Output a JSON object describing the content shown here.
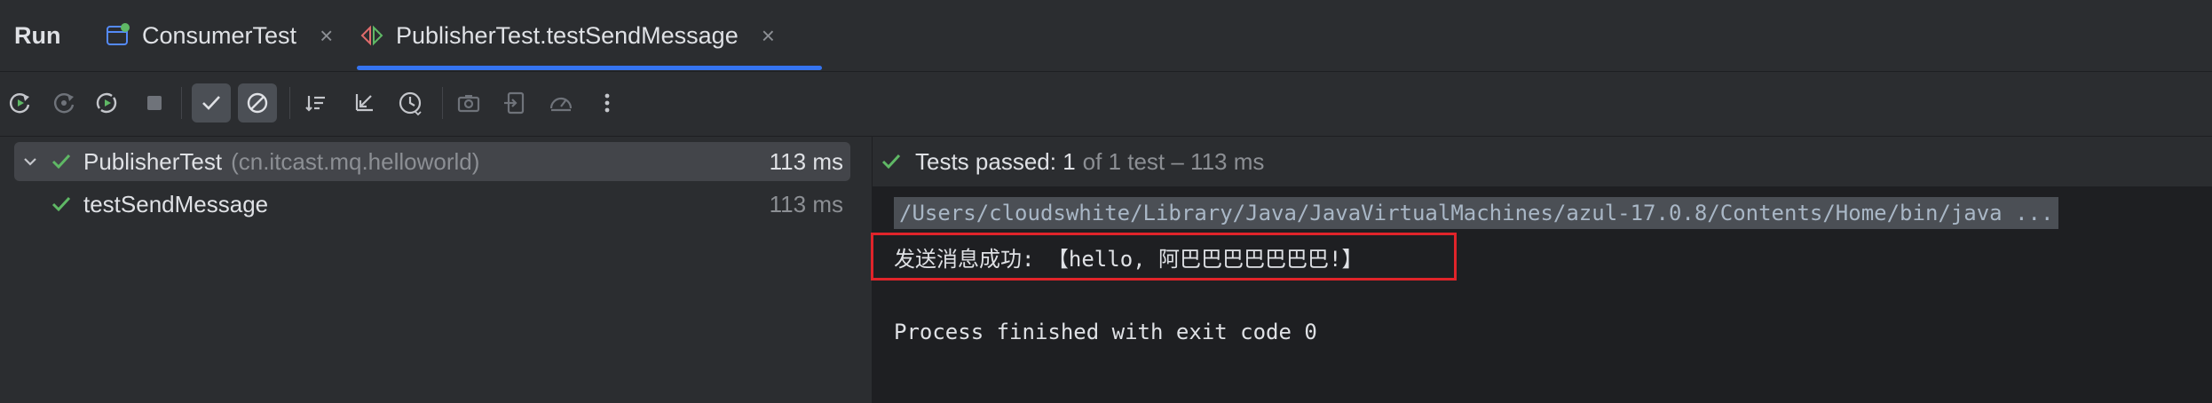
{
  "header": {
    "run_label": "Run",
    "tabs": [
      {
        "label": "ConsumerTest",
        "icon": "test-class-icon",
        "close": "×"
      },
      {
        "label": "PublisherTest.testSendMessage",
        "icon": "junit-icon",
        "close": "×",
        "active": true
      }
    ]
  },
  "toolbar": {
    "buttons": [
      "rerun-icon",
      "rerun-failed-icon",
      "toggle-auto-test-icon",
      "stop-icon",
      "show-passed-icon",
      "show-ignored-icon",
      "sort-alphabetically-icon",
      "collapse-all-icon",
      "sort-by-duration-icon",
      "screenshot-icon",
      "import-tests-icon",
      "coverage-icon",
      "more-icon"
    ]
  },
  "tree": {
    "root": {
      "name": "PublisherTest",
      "package": "(cn.itcast.mq.helloworld)",
      "duration": "113 ms"
    },
    "child": {
      "name": "testSendMessage",
      "duration": "113 ms"
    }
  },
  "console": {
    "status_passed": "Tests passed: 1",
    "status_detail": "of 1 test – 113 ms",
    "cmd": "/Users/cloudswhite/Library/Java/JavaVirtualMachines/azul-17.0.8/Contents/Home/bin/java ...",
    "message": "发送消息成功: 【hello, 阿巴巴巴巴巴巴巴!】",
    "exit": "Process finished with exit code 0"
  },
  "colors": {
    "accent": "#3574f0",
    "pass": "#5fb865",
    "highlight": "#e0242a",
    "background": "#2b2d30"
  }
}
